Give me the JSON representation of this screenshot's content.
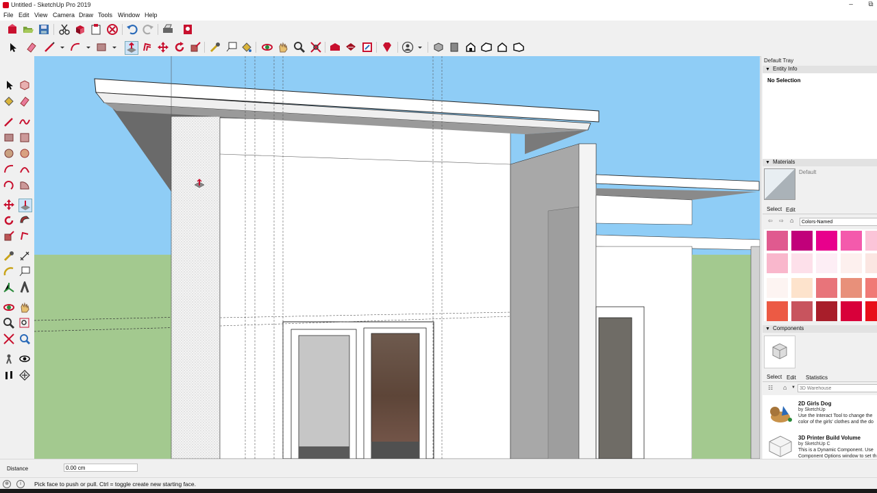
{
  "window": {
    "title": "Untitled - SketchUp Pro 2019",
    "minimize": "–",
    "restore": "⧉"
  },
  "menu": [
    "File",
    "Edit",
    "View",
    "Camera",
    "Draw",
    "Tools",
    "Window",
    "Help"
  ],
  "toolbar_icons": {
    "row1": [
      "new-model-icon",
      "open-icon",
      "save-icon",
      "cut-icon",
      "copy-icon",
      "paste-icon",
      "erase-icon",
      "undo-icon",
      "redo-icon",
      "print-icon",
      "model-info-icon"
    ],
    "row2": [
      "select-icon",
      "eraser-icon",
      "line-icon",
      "arc-icon",
      "rectangle-icon",
      "push-pull-icon",
      "offset-icon",
      "move-icon",
      "rotate-icon",
      "scale-icon",
      "tape-measure-icon",
      "text-icon",
      "paint-bucket-icon",
      "orbit-icon",
      "pan-icon",
      "zoom-icon",
      "zoom-extents-icon",
      "warehouse-icon",
      "extension-warehouse-icon",
      "layout-icon",
      "ruby-icon",
      "account-icon",
      "iso-view-icon",
      "top-view-icon",
      "front-view-icon",
      "right-view-icon",
      "back-view-icon",
      "left-view-icon"
    ]
  },
  "tray": {
    "title": "Default Tray",
    "entity_info": {
      "header": "Entity Info",
      "value": "No Selection"
    },
    "materials": {
      "header": "Materials",
      "current": "Default",
      "tabs": [
        "Select",
        "Edit"
      ],
      "library": "Colors-Named",
      "swatches": [
        "#e05a8f",
        "#c1007a",
        "#e8008c",
        "#f45aac",
        "#fbc4d8",
        "#f9b7cc",
        "#fde0ea",
        "#fdeef5",
        "#fdf0ee",
        "#fbe6e2",
        "#fdf4f2",
        "#fde3cc",
        "#e8747a",
        "#e8907a",
        "#f07a76",
        "#ec5a44",
        "#c8545e",
        "#a81e2a",
        "#d8003a",
        "#e8101a"
      ]
    },
    "components": {
      "header": "Components",
      "tabs": [
        "Select",
        "Edit",
        "Statistics"
      ],
      "search_placeholder": "3D Warehouse",
      "items": [
        {
          "title": "2D Girls Dog",
          "by": "by SketchUp",
          "desc": "Use the Interact Tool to change the color of the girls' clothes and the do"
        },
        {
          "title": "3D Printer Build Volume",
          "by": "by SketchUp C",
          "desc": "This is a Dynamic Component. Use Component Options window to set th"
        }
      ]
    }
  },
  "measurements": {
    "label": "Distance",
    "value": "0.00 cm"
  },
  "status": {
    "message": "Pick face to push or pull.  Ctrl = toggle create new starting face."
  },
  "colors": {
    "sky": "#8fcdf6",
    "ground": "#a3c98f",
    "accent": "#c8102e"
  }
}
